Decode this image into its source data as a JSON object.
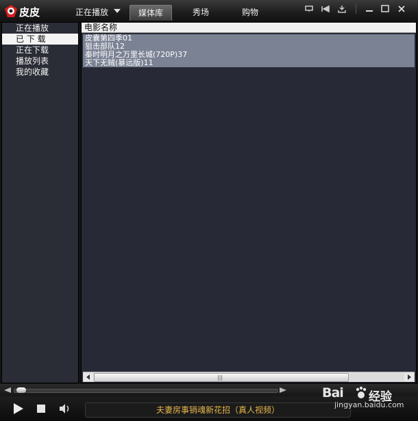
{
  "app": {
    "title": "皮皮"
  },
  "nav": {
    "now_playing": "正在播放",
    "media_library": "媒体库",
    "show": "秀场",
    "shopping": "购物"
  },
  "sidebar": {
    "items": [
      {
        "label": "正在播放"
      },
      {
        "label": "已 下 载",
        "selected": true
      },
      {
        "label": "正在下载"
      },
      {
        "label": "播放列表"
      },
      {
        "label": "我的收藏"
      }
    ]
  },
  "list": {
    "column_header": "电影名称",
    "rows": [
      "皮囊第四季01",
      "狙击部队12",
      "秦时明月之万里长城(720P)37",
      "天下无贼(暴远版)11"
    ]
  },
  "player": {
    "ticker_text": "夫妻房事销魂新花招（真人视频）",
    "progress": 0.01
  },
  "watermark": {
    "brand": "Bai",
    "brand_cn": "经验",
    "domain": "jingyan.baidu.com"
  },
  "colors": {
    "list_bg": "#272a36",
    "row_highlight": "#7b8294",
    "ticker_text": "#e8b64a"
  }
}
